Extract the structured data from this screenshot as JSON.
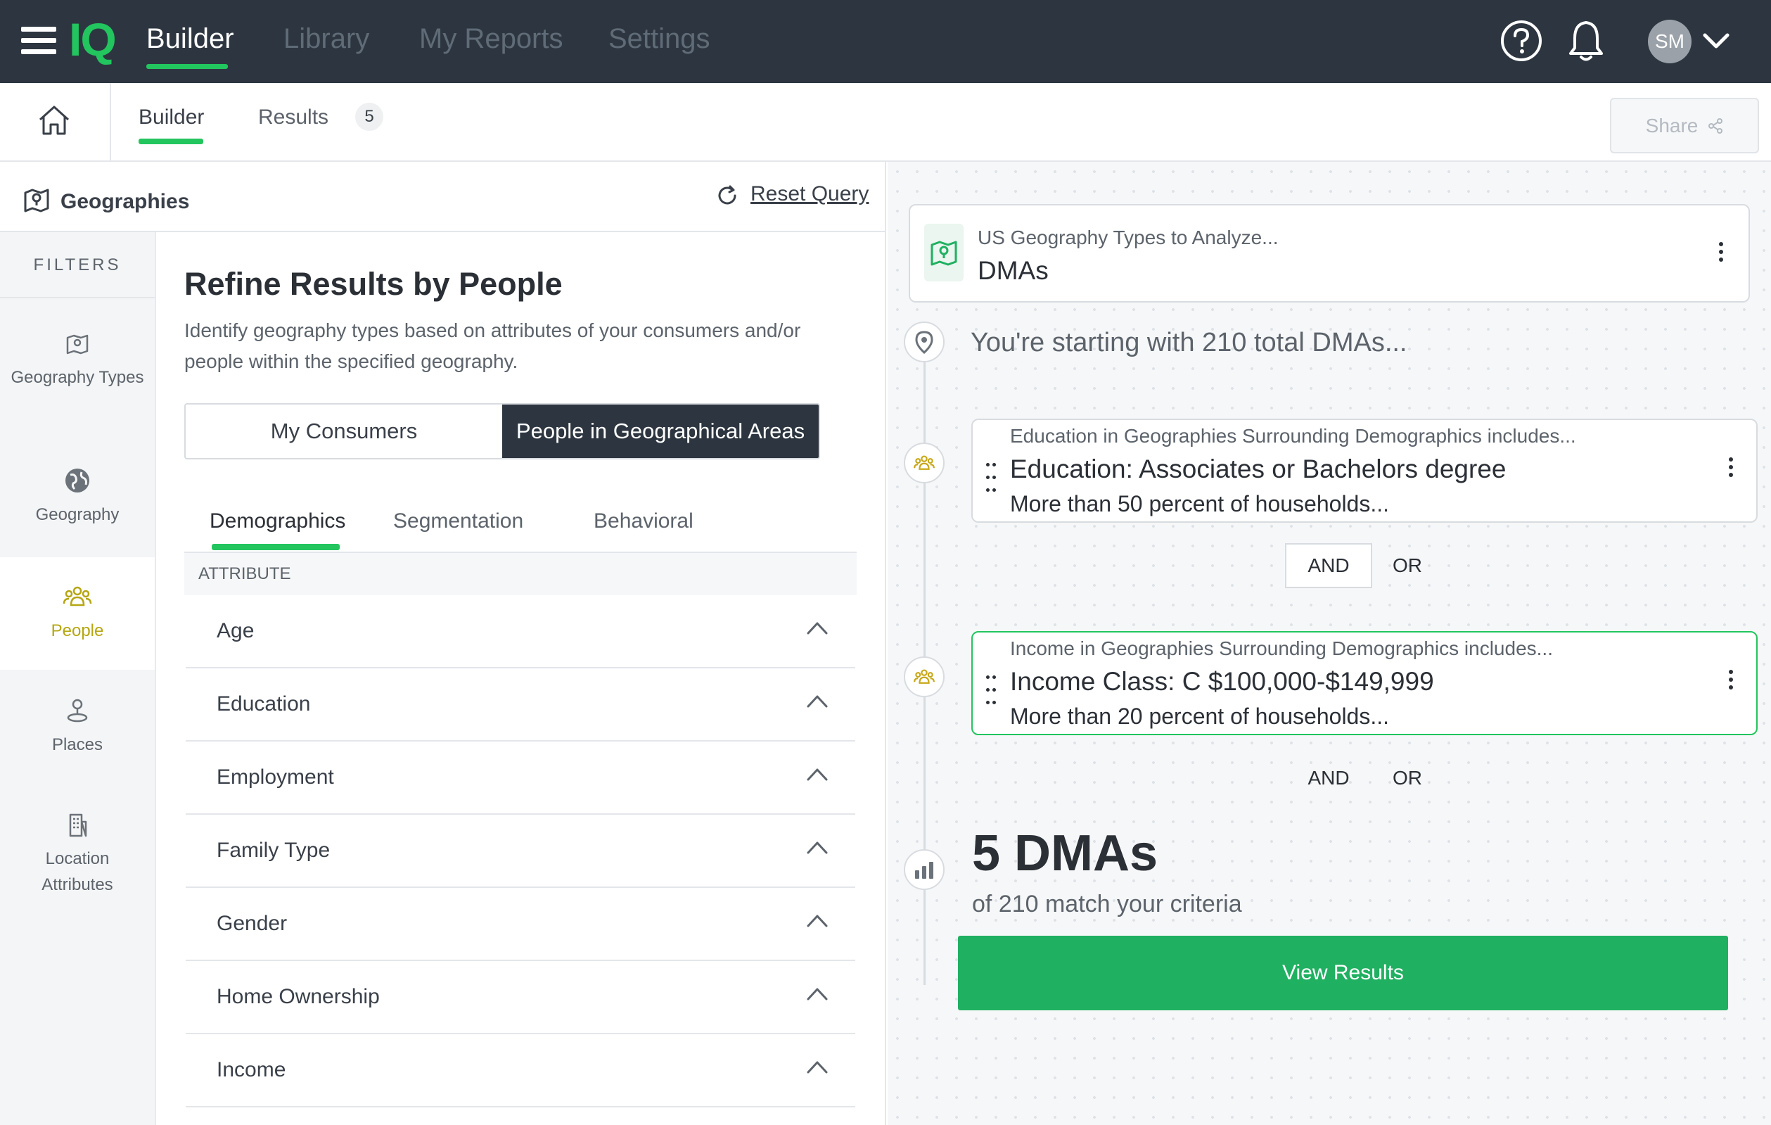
{
  "topnav": {
    "logo": "IQ",
    "items": [
      "Builder",
      "Library",
      "My Reports",
      "Settings"
    ],
    "avatar_initials": "SM"
  },
  "subnav": {
    "tabs": [
      "Builder",
      "Results"
    ],
    "results_count": "5",
    "share_label": "Share"
  },
  "left_header": {
    "title": "Geographies",
    "reset_label": "Reset Query"
  },
  "filters": {
    "title": "FILTERS",
    "items": [
      {
        "label": "Geography Types",
        "icon": "map-pin-icon"
      },
      {
        "label": "Geography",
        "icon": "globe-icon"
      },
      {
        "label": "People",
        "icon": "people-icon"
      },
      {
        "label": "Places",
        "icon": "place-pin-icon"
      },
      {
        "label": "Location Attributes",
        "icon": "building-icon"
      }
    ],
    "active_index": 2
  },
  "refine": {
    "title": "Refine Results by People",
    "description": "Identify geography types based on attributes of your consumers and/or people within the specified geography.",
    "toggle": [
      "My Consumers",
      "People in Geographical Areas"
    ],
    "tabs": [
      "Demographics",
      "Segmentation",
      "Behavioral"
    ],
    "attribute_header": "ATTRIBUTE",
    "attributes": [
      "Age",
      "Education",
      "Employment",
      "Family Type",
      "Gender",
      "Home Ownership",
      "Income"
    ]
  },
  "query": {
    "geo_card": {
      "subtitle": "US Geography Types to Analyze...",
      "value": "DMAs"
    },
    "start_text": "You're starting with 210 total DMAs...",
    "cards": [
      {
        "subtitle": "Education in Geographies Surrounding Demographics includes...",
        "main": "Education: Associates or Bachelors degree",
        "detail": "More than 50 percent of households..."
      },
      {
        "subtitle": "Income in Geographies Surrounding Demographics includes...",
        "main": "Income Class: C $100,000-$149,999",
        "detail": "More than 20 percent of households..."
      }
    ],
    "logic": {
      "and": "AND",
      "or": "OR"
    },
    "result_count": "5 DMAs",
    "result_sub": "of 210 match your criteria",
    "view_button": "View Results"
  },
  "colors": {
    "accent": "#22c55e",
    "nav_bg": "#2d3640",
    "people_active": "#b5a611",
    "view_button": "#20b061"
  }
}
